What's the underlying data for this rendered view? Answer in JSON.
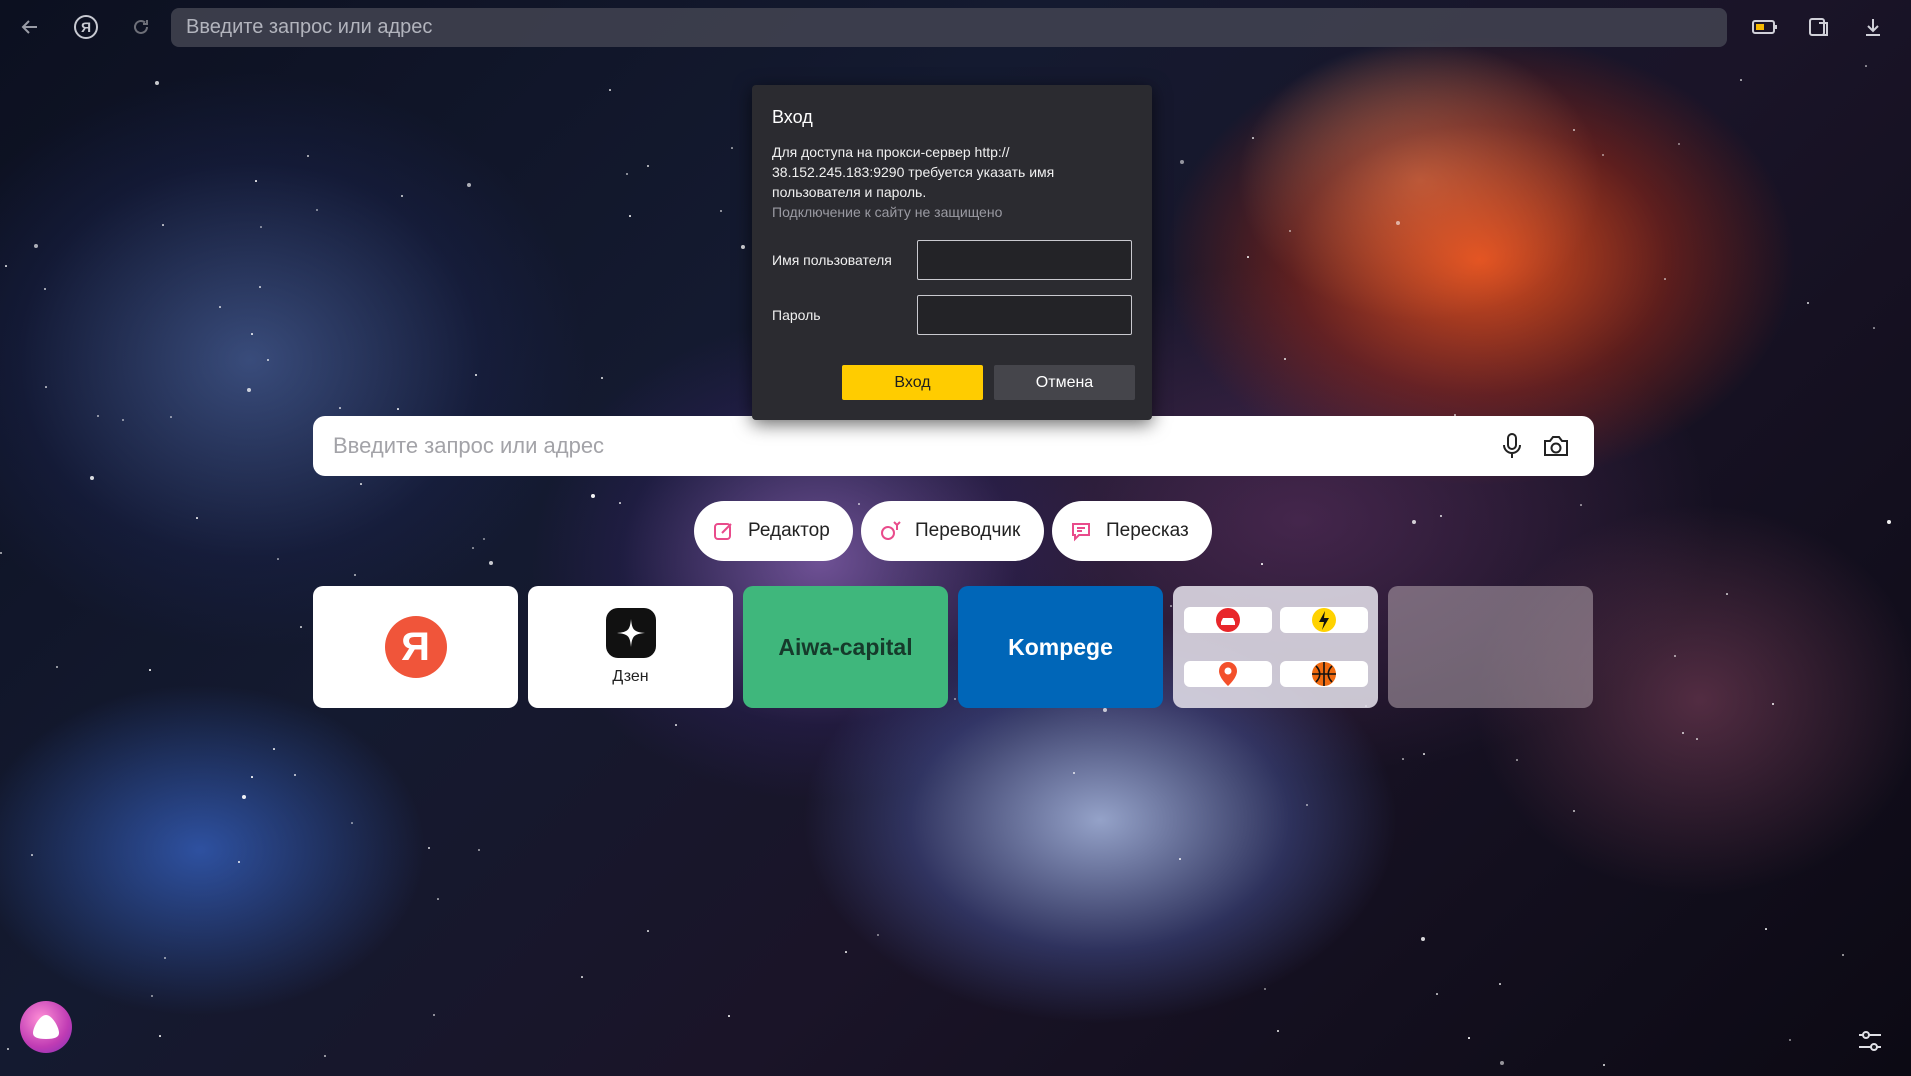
{
  "browser": {
    "address_placeholder": "Введите запрос или адрес",
    "icons": [
      "back-arrow-icon",
      "yandex-logo-icon",
      "reload-icon",
      "battery-icon",
      "reader-mode-icon",
      "download-icon"
    ]
  },
  "dialog": {
    "title": "Вход",
    "message": "Для доступа на прокси-сервер http:// 38.152.245.183:9290 требуется указать имя пользователя и пароль.",
    "subtext": "Подключение к сайту не защищено",
    "username_label": "Имя пользователя",
    "username_value": "",
    "password_label": "Пароль",
    "password_value": "",
    "login_button": "Вход",
    "cancel_button": "Отмена",
    "login_color": "#ffcc00"
  },
  "search": {
    "placeholder": "Введите запрос или адрес",
    "icons": [
      "microphone-icon",
      "camera-search-icon"
    ]
  },
  "pills": [
    {
      "label": "Редактор",
      "icon": "editor-icon"
    },
    {
      "label": "Переводчик",
      "icon": "translator-icon"
    },
    {
      "label": "Пересказ",
      "icon": "summary-icon"
    }
  ],
  "tiles": {
    "yandex_letter": "Я",
    "dzen_label": "Дзен",
    "aiwa_label": "Aiwa-capital",
    "kompege_label": "Kompege",
    "group_icons": [
      "car-icon",
      "lightning-logo-icon",
      "map-pin-icon",
      "basketball-icon"
    ]
  },
  "bottom": {
    "icons": [
      "alice-icon",
      "settings-sliders-icon"
    ]
  }
}
